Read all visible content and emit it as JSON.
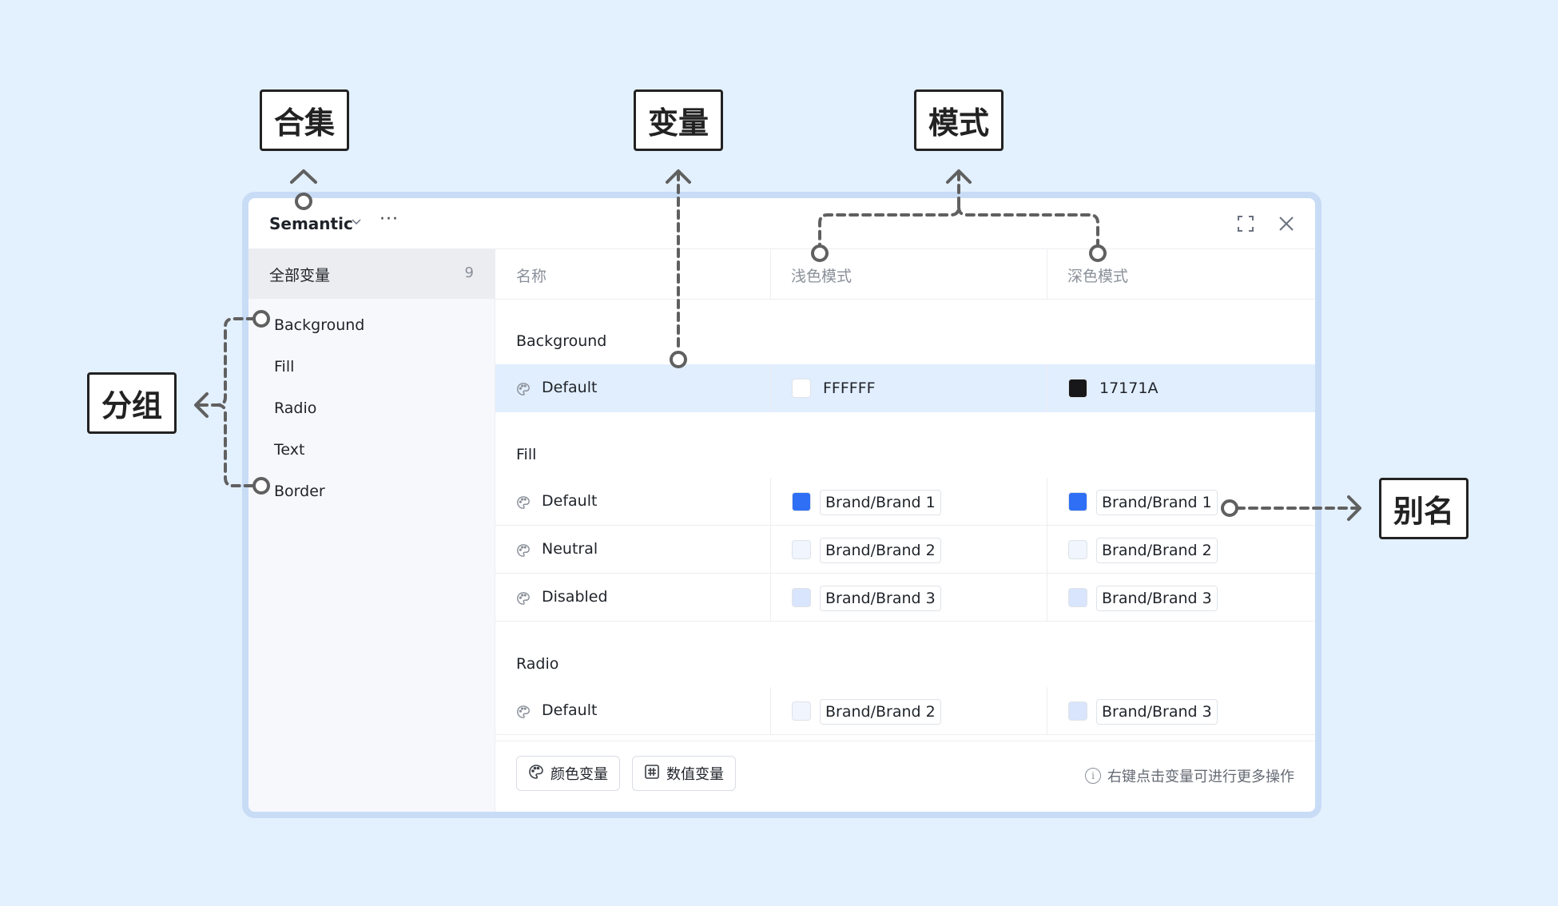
{
  "callouts": {
    "collection": "合集",
    "variable": "变量",
    "mode": "模式",
    "group": "分组",
    "alias": "别名"
  },
  "titlebar": {
    "collection_name": "Semantic",
    "dropdown_icon": "chevron-down-icon",
    "more_label": "···"
  },
  "sidebar": {
    "all_label": "全部变量",
    "all_count": "9",
    "groups": [
      "Background",
      "Fill",
      "Radio",
      "Text",
      "Border"
    ]
  },
  "table": {
    "headers": [
      "名称",
      "浅色模式",
      "深色模式"
    ],
    "sections": [
      {
        "title": "Background",
        "rows": [
          {
            "name": "Default",
            "light": {
              "value": "FFFFFF",
              "color": "#ffffff"
            },
            "dark": {
              "value": "17171A",
              "color": "#17171a"
            }
          }
        ]
      },
      {
        "title": "Fill",
        "rows": [
          {
            "name": "Default",
            "light": {
              "value": "Brand/Brand 1",
              "color": "#2e6ff5"
            },
            "dark": {
              "value": "Brand/Brand 1",
              "color": "#2e6ff5"
            }
          },
          {
            "name": "Neutral",
            "light": {
              "value": "Brand/Brand 2",
              "color": "#f0f5fe"
            },
            "dark": {
              "value": "Brand/Brand 2",
              "color": "#f0f5fe"
            }
          },
          {
            "name": "Disabled",
            "light": {
              "value": "Brand/Brand 3",
              "color": "#d9e5fc"
            },
            "dark": {
              "value": "Brand/Brand 3",
              "color": "#d9e5fc"
            }
          }
        ]
      },
      {
        "title": "Radio",
        "rows": [
          {
            "name": "Default",
            "light": {
              "value": "Brand/Brand 2",
              "color": "#f0f5fe"
            },
            "dark": {
              "value": "Brand/Brand 3",
              "color": "#d9e5fc"
            }
          }
        ]
      }
    ]
  },
  "footer": {
    "color_var_label": "颜色变量",
    "number_var_label": "数值变量",
    "hint": "右键点击变量可进行更多操作"
  },
  "colors": {
    "background": "#e3f0fe",
    "panel_border": "#c8dcf6",
    "selected_row": "#e1eefe",
    "annotation": "#606060"
  }
}
